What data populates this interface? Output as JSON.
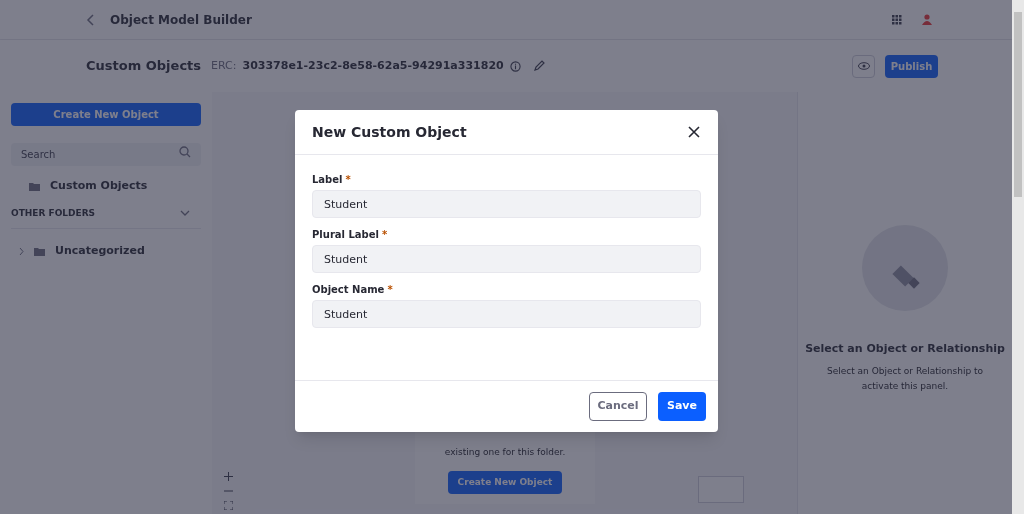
{
  "header": {
    "title": "Object Model Builder"
  },
  "toolbar": {
    "title": "Custom Objects",
    "erc_label": "ERC:",
    "erc_value": "303378e1-23c2-8e58-62a5-94291a331820",
    "publish_button": "Publish"
  },
  "sidebar": {
    "create_button": "Create New Object",
    "search": {
      "placeholder": "Search"
    },
    "root_folder": "Custom Objects",
    "section_title": "OTHER FOLDERS",
    "section_expanded": true,
    "folders": [
      {
        "label": "Uncategorized",
        "expanded": false
      }
    ]
  },
  "canvas": {
    "empty_text": "existing one for this folder.",
    "create_button": "Create New Object"
  },
  "details_panel": {
    "title": "Select an Object or Relationship",
    "description": "Select an Object or Relationship to activate this panel."
  },
  "dialog": {
    "title": "New Custom Object",
    "fields": [
      {
        "label": "Label",
        "required_mark": "*",
        "value": "Student"
      },
      {
        "label": "Plural Label",
        "required_mark": "*",
        "value": "Student"
      },
      {
        "label": "Object Name",
        "required_mark": "*",
        "value": "Student"
      }
    ],
    "cancel_button": "Cancel",
    "save_button": "Save"
  }
}
